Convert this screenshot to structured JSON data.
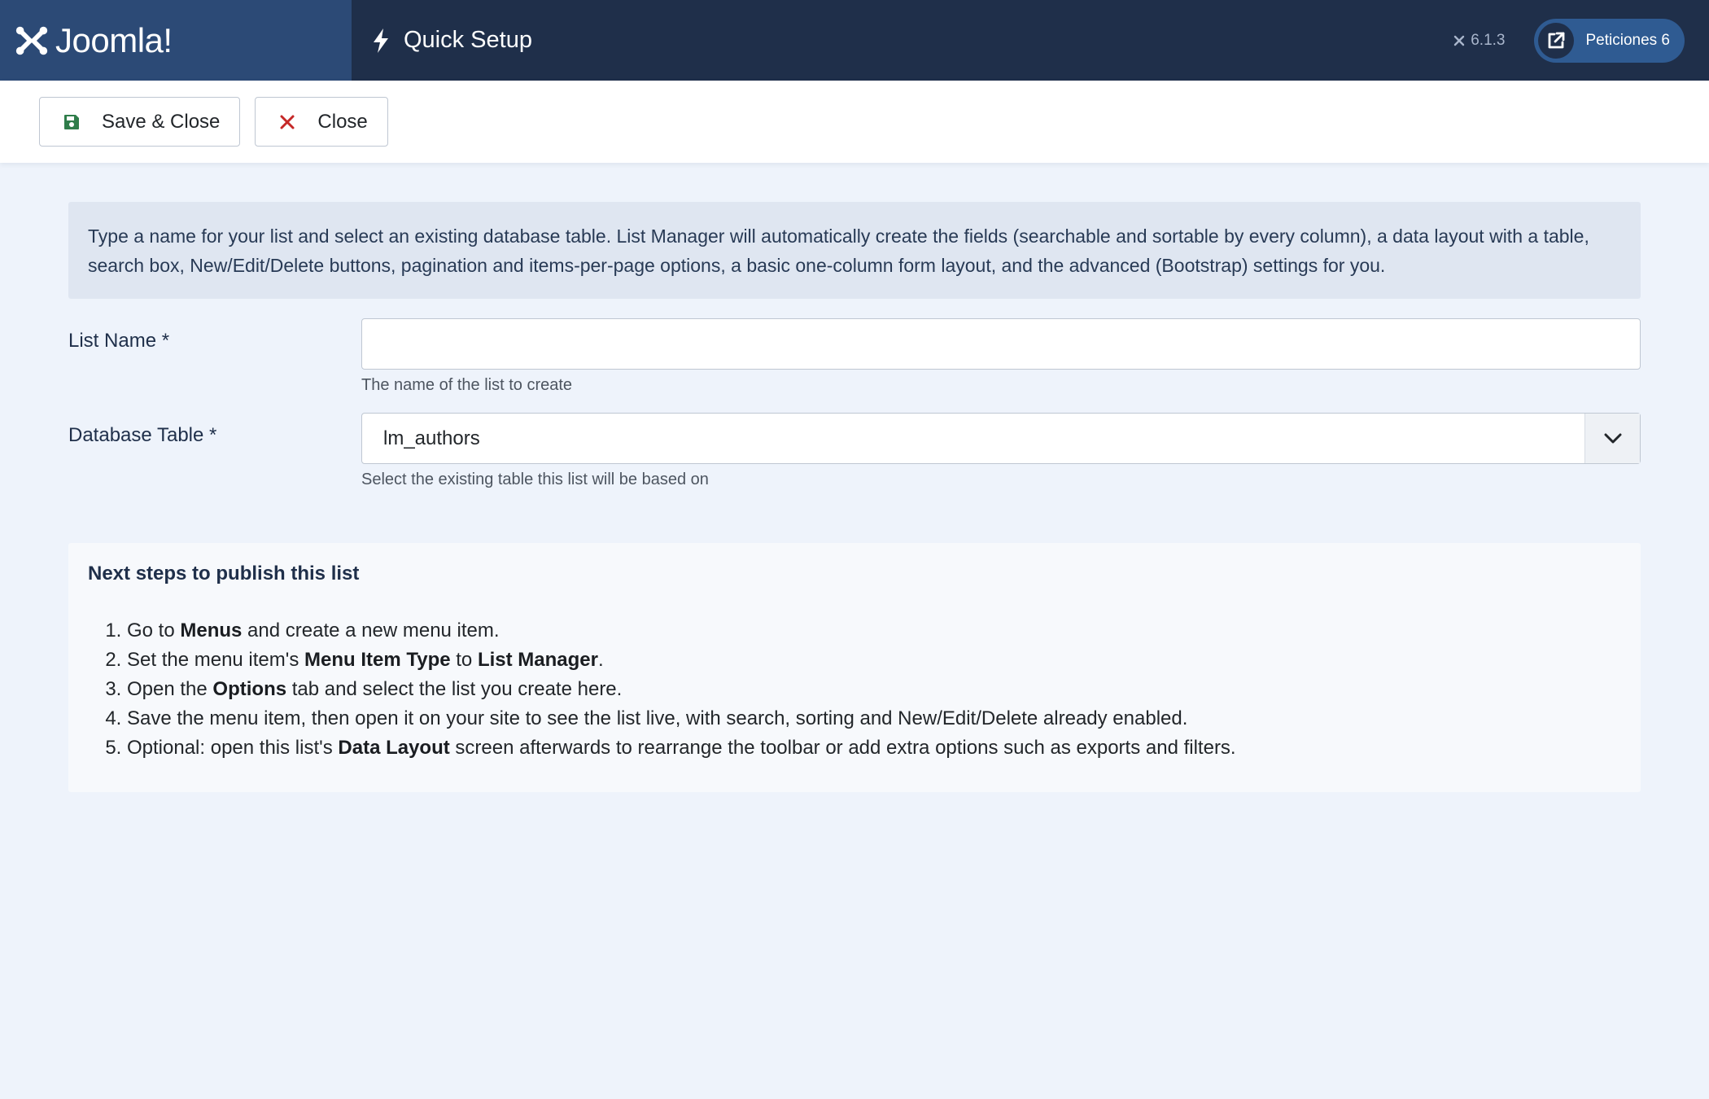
{
  "header": {
    "logo_text": "Joomla!",
    "page_title": "Quick Setup",
    "version": "6.1.3",
    "user_label": "Peticiones 6"
  },
  "toolbar": {
    "save_close_label": "Save & Close",
    "close_label": "Close"
  },
  "intro": "Type a name for your list and select an existing database table. List Manager will automatically create the fields (searchable and sortable by every column), a data layout with a table, search box, New/Edit/Delete buttons, pagination and items-per-page options, a basic one-column form layout, and the advanced (Bootstrap) settings for you.",
  "form": {
    "list_name": {
      "label": "List Name *",
      "value": "",
      "help": "The name of the list to create"
    },
    "database_table": {
      "label": "Database Table *",
      "value": "lm_authors",
      "help": "Select the existing table this list will be based on"
    }
  },
  "steps": {
    "title": "Next steps to publish this list",
    "items": [
      {
        "a": "Go to ",
        "b": "Menus",
        "c": " and create a new menu item."
      },
      {
        "a": "Set the menu item's ",
        "b": "Menu Item Type",
        "c": " to ",
        "d": "List Manager",
        "e": "."
      },
      {
        "a": "Open the ",
        "b": "Options",
        "c": " tab and select the list you create here."
      },
      {
        "a": "Save the menu item, then open it on your site to see the list live, with search, sorting and New/Edit/Delete already enabled."
      },
      {
        "a": "Optional: open this list's ",
        "b": "Data Layout",
        "c": " screen afterwards to rearrange the toolbar or add extra options such as exports and filters."
      }
    ]
  },
  "colors": {
    "header_bg": "#1f2f4a",
    "logo_bg": "#2c4a76",
    "save_icon": "#2f7d4a",
    "close_icon": "#c52827",
    "page_bg": "#eef3fb"
  },
  "icons": {
    "logo": "joomla-logo-icon",
    "title": "bolt-icon",
    "version": "joomla-small-icon",
    "user": "external-link-icon",
    "save": "floppy-disk-icon",
    "close": "close-icon",
    "select": "chevron-down-icon"
  }
}
